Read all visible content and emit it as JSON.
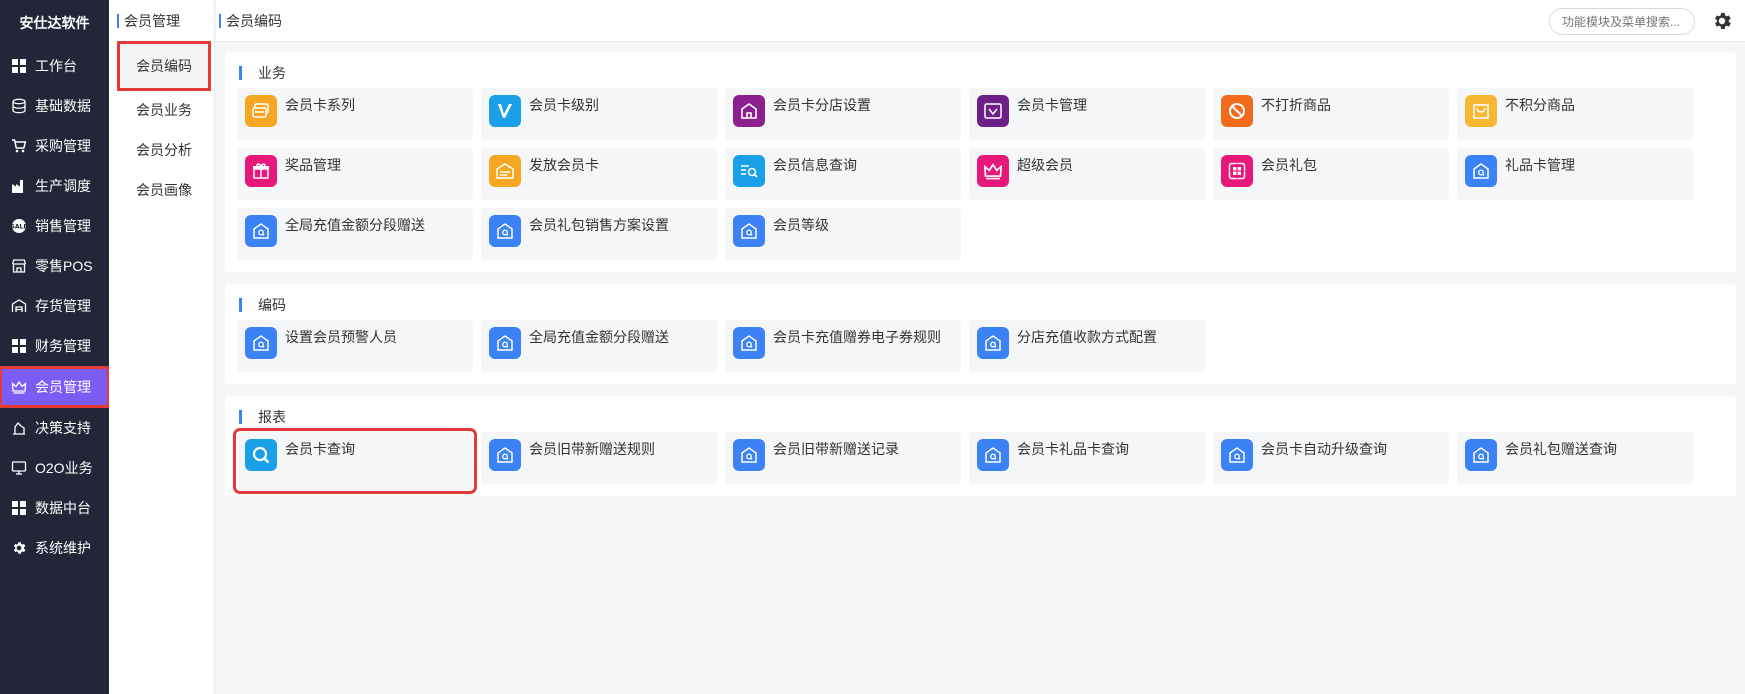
{
  "brand": "安仕达软件",
  "sidebar": {
    "items": [
      {
        "label": "工作台",
        "icon": "grid-icon"
      },
      {
        "label": "基础数据",
        "icon": "database-icon"
      },
      {
        "label": "采购管理",
        "icon": "cart-icon"
      },
      {
        "label": "生产调度",
        "icon": "factory-icon"
      },
      {
        "label": "销售管理",
        "icon": "sale-badge-icon"
      },
      {
        "label": "零售POS",
        "icon": "store-icon"
      },
      {
        "label": "存货管理",
        "icon": "warehouse-icon"
      },
      {
        "label": "财务管理",
        "icon": "grid-icon"
      },
      {
        "label": "会员管理",
        "icon": "crown-icon",
        "active": true
      },
      {
        "label": "决策支持",
        "icon": "decision-icon"
      },
      {
        "label": "O2O业务",
        "icon": "monitor-icon"
      },
      {
        "label": "数据中台",
        "icon": "grid-icon"
      },
      {
        "label": "系统维护",
        "icon": "gear-icon"
      }
    ]
  },
  "submenu": {
    "title": "会员管理",
    "items": [
      "会员编码",
      "会员业务",
      "会员分析",
      "会员画像"
    ],
    "active_index": 0
  },
  "topbar": {
    "breadcrumb": "会员编码",
    "search_placeholder": "功能模块及菜单搜索..."
  },
  "colors": {
    "sidebar_bg": "#232638",
    "active_purple": "#7b5cf5",
    "highlight_red": "#e53935",
    "accent_blue": "#3b82f6"
  },
  "sections": [
    {
      "title": "业务",
      "tiles": [
        {
          "label": "会员卡系列",
          "icon": "card-series-icon",
          "color": "#f5a623"
        },
        {
          "label": "会员卡级别",
          "icon": "v-letter-icon",
          "color": "#1aa0e8"
        },
        {
          "label": "会员卡分店设置",
          "icon": "home-icon",
          "color": "#8e1f8e"
        },
        {
          "label": "会员卡管理",
          "icon": "card-manage-icon",
          "color": "#6b1f87"
        },
        {
          "label": "不打折商品",
          "icon": "forbidden-icon",
          "color": "#f26b1d"
        },
        {
          "label": "不积分商品",
          "icon": "bag-icon",
          "color": "#f7b733"
        },
        {
          "label": "奖品管理",
          "icon": "gift-icon",
          "color": "#e8177a"
        },
        {
          "label": "发放会员卡",
          "icon": "issue-card-icon",
          "color": "#f5a623"
        },
        {
          "label": "会员信息查询",
          "icon": "search-list-icon",
          "color": "#1aa0e8"
        },
        {
          "label": "超级会员",
          "icon": "crown-icon",
          "color": "#e8177a"
        },
        {
          "label": "会员礼包",
          "icon": "gift-box-icon",
          "color": "#e8177a"
        },
        {
          "label": "礼品卡管理",
          "icon": "house-q-icon",
          "color": "#3b82f6"
        },
        {
          "label": "全局充值金额分段赠送",
          "icon": "house-q-icon",
          "color": "#3b82f6"
        },
        {
          "label": "会员礼包销售方案设置",
          "icon": "house-q-icon",
          "color": "#3b82f6"
        },
        {
          "label": "会员等级",
          "icon": "house-q-icon",
          "color": "#3b82f6"
        }
      ]
    },
    {
      "title": "编码",
      "tiles": [
        {
          "label": "设置会员预警人员",
          "icon": "house-q-icon",
          "color": "#3b82f6"
        },
        {
          "label": "全局充值金额分段赠送",
          "icon": "house-q-icon",
          "color": "#3b82f6"
        },
        {
          "label": "会员卡充值赠券电子券规则",
          "icon": "house-q-icon",
          "color": "#3b82f6"
        },
        {
          "label": "分店充值收款方式配置",
          "icon": "house-q-icon",
          "color": "#3b82f6"
        }
      ]
    },
    {
      "title": "报表",
      "tiles": [
        {
          "label": "会员卡查询",
          "icon": "search-icon",
          "color": "#1aa0e8",
          "highlight": true
        },
        {
          "label": "会员旧带新赠送规则",
          "icon": "house-q-icon",
          "color": "#3b82f6"
        },
        {
          "label": "会员旧带新赠送记录",
          "icon": "house-q-icon",
          "color": "#3b82f6"
        },
        {
          "label": "会员卡礼品卡查询",
          "icon": "house-q-icon",
          "color": "#3b82f6"
        },
        {
          "label": "会员卡自动升级查询",
          "icon": "house-q-icon",
          "color": "#3b82f6"
        },
        {
          "label": "会员礼包赠送查询",
          "icon": "house-q-icon",
          "color": "#3b82f6"
        }
      ]
    }
  ]
}
